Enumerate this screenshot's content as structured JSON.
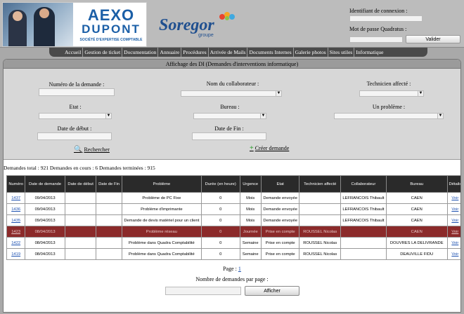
{
  "header": {
    "aexo_logo": {
      "line1": "AEXO",
      "line2": "DUPONT",
      "tagline": "SOCIÉTÉ D'EXPERTISE COMPTABLE"
    },
    "soregor_logo": {
      "name": "Soregor",
      "sub": "groupe"
    },
    "login": {
      "id_label": "Identifiant de connexion :",
      "pw_label": "Mot de passe Quadratus :",
      "submit": "Valider"
    }
  },
  "menu": [
    "Accueil",
    "Gestion de ticket",
    "Documentation",
    "Annuaire",
    "Procédures",
    "Arrivée de Mails",
    "Documents Internes",
    "Galerie photos",
    "Sites utiles",
    "Informatique"
  ],
  "main": {
    "title": "Affichage des DI (Demandes d'interventions informatique)",
    "filters": {
      "numero_label": "Numéro de la demande :",
      "collaborateur_label": "Nom du collaborateur :",
      "technicien_label": "Technicien affecté :",
      "etat_label": "Etat :",
      "bureau_label": "Bureau :",
      "probleme_label": "Un problème :",
      "date_debut_label": "Date de début :",
      "date_fin_label": "Date de Fin :",
      "search": "Rechercher",
      "create": "Créer demande"
    },
    "stats": "Demandes total : 921 Demandes en cours : 6 Demandes terminées : 915",
    "table": {
      "headers": [
        "Numéro",
        "Date de demande",
        "Date de début",
        "Date de Fin",
        "Problème",
        "Durée (en heure)",
        "Urgence",
        "Etat",
        "Technicien affecté",
        "Collaborateur",
        "Bureau",
        "Détails"
      ],
      "rows": [
        [
          "1437",
          "09/04/2013",
          "",
          "",
          "Problème de PC Fixe",
          "0",
          "Mois",
          "Demande envoyée",
          "",
          "LEFRANCOIS Thibault",
          "CAEN",
          "Voir"
        ],
        [
          "1436",
          "09/04/2013",
          "",
          "",
          "Problème d'imprimante",
          "0",
          "Mois",
          "Demande envoyée",
          "",
          "LEFRANCOIS Thibault",
          "CAEN",
          "Voir"
        ],
        [
          "1435",
          "09/04/2013",
          "",
          "",
          "Demande de devis matériel pour un client",
          "0",
          "Mois",
          "Demande envoyée",
          "",
          "LEFRANCOIS Thibault",
          "CAEN",
          "Voir"
        ],
        [
          "1423",
          "08/04/2013",
          "",
          "",
          "Problème réseau",
          "0",
          "Journée",
          "Prise en compte",
          "ROUSSEL Nicolas",
          "",
          "CAEN",
          "Voir"
        ],
        [
          "1422",
          "08/04/2013",
          "",
          "",
          "Problème dans Quadra Comptabilité",
          "0",
          "Semaine",
          "Prise en compte",
          "ROUSSEL Nicolas",
          "",
          "DOUVRES LA DELIVRANDE",
          "Voir"
        ],
        [
          "1419",
          "08/04/2013",
          "",
          "",
          "Problème dans Quadra Comptabilité",
          "0",
          "Semaine",
          "Prise en compte",
          "ROUSSEL Nicolas",
          "",
          "DEAUVILLE FIDU",
          "Voir"
        ]
      ]
    },
    "pagination": {
      "label": "Page :",
      "page": "1"
    },
    "per_page": {
      "label": "Nombre de demandes par page :",
      "button": "Afficher"
    }
  },
  "colors": {
    "menu_bg": "#4a4a4a",
    "selected_row": "#8b2a2a",
    "header_bg": "#2a2a2a",
    "link": "#1a4fb0"
  }
}
